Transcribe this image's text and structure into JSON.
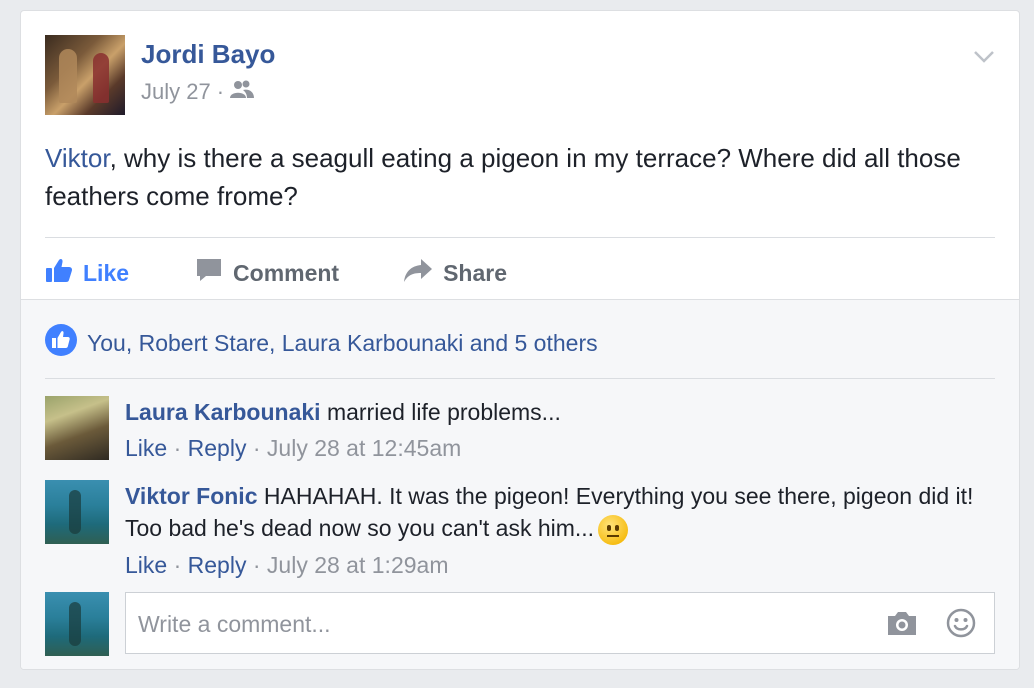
{
  "post": {
    "author": "Jordi Bayo",
    "date": "July 27",
    "separator": "·",
    "audience_icon": "friends-icon",
    "mention": "Viktor",
    "text": ", why is there a seagull eating a pigeon in my terrace? Where did all those feathers come frome?"
  },
  "actions": {
    "like": "Like",
    "comment": "Comment",
    "share": "Share"
  },
  "reactions": {
    "summary": "You, Robert Stare, Laura Karbounaki and 5 others"
  },
  "comments": [
    {
      "author": "Laura Karbounaki",
      "text": "married life problems...",
      "like": "Like",
      "reply": "Reply",
      "time": "July 28 at 12:45am",
      "sep": "·"
    },
    {
      "author": "Viktor Fonic",
      "text": "HAHAHAH. It was the pigeon! Everything you see there, pigeon did it! Too bad he's dead now so you can't ask him...",
      "emoji": "confused-face",
      "like": "Like",
      "reply": "Reply",
      "time": "July 28 at 1:29am",
      "sep": "·"
    }
  ],
  "composer": {
    "placeholder": "Write a comment..."
  },
  "colors": {
    "link": "#365899",
    "like_active": "#4080ff",
    "muted": "#90949c",
    "background": "#e9ebee"
  }
}
